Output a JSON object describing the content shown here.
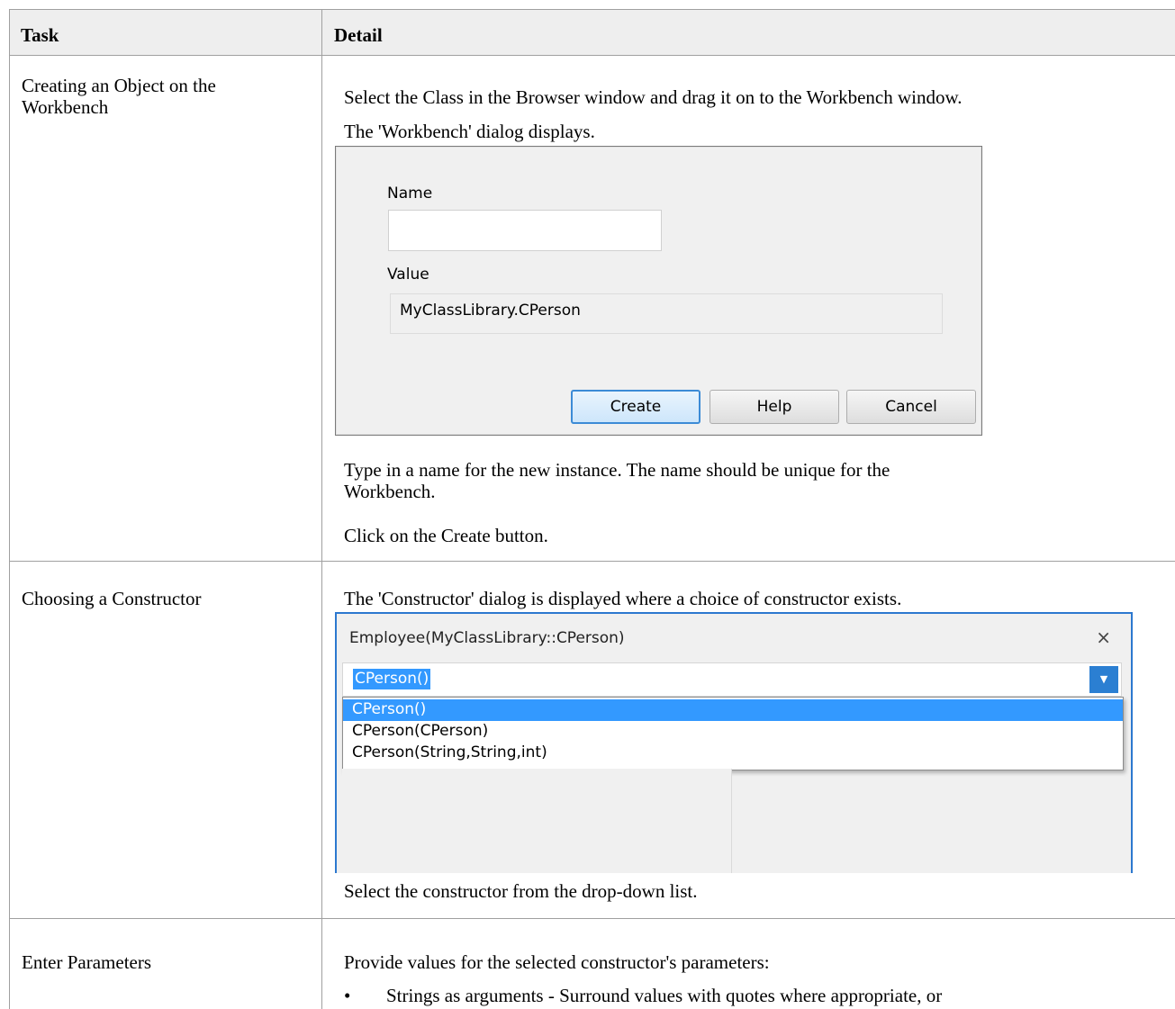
{
  "header": {
    "task": "Task",
    "detail": "Detail"
  },
  "rows": [
    {
      "task": "Creating an Object on the Workbench",
      "lines": [
        "Select the Class in the Browser window and drag it on to the Workbench window.",
        "The 'Workbench' dialog displays.",
        "Type in a name for the new instance. The name should be unique for the",
        "Workbench.",
        "Click on the Create button."
      ]
    },
    {
      "task": "Choosing a Constructor",
      "lines": [
        "The 'Constructor' dialog is displayed where a choice of constructor exists.",
        "Select the constructor from the drop-down list."
      ]
    },
    {
      "task": "Enter Parameters",
      "lines": [
        "Provide values for the selected constructor's parameters:",
        "Strings as arguments - Surround values with quotes where appropriate, or"
      ]
    }
  ],
  "workbench_dialog": {
    "name_label": "Name",
    "name_value": "",
    "value_label": "Value",
    "value_text": "MyClassLibrary.CPerson",
    "buttons": {
      "create": "Create",
      "help": "Help",
      "cancel": "Cancel"
    }
  },
  "constructor_dialog": {
    "title": "Employee(MyClassLibrary::CPerson)",
    "close_glyph": "×",
    "selected": "CPerson()",
    "dropdown_glyph": "▼",
    "options": [
      "CPerson()",
      "CPerson(CPerson)",
      "CPerson(String,String,int)"
    ],
    "highlighted_index": 0
  }
}
